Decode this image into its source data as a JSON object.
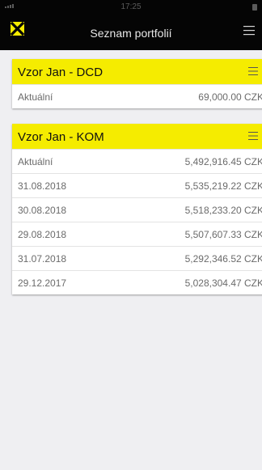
{
  "status_bar": {
    "time": "17:25"
  },
  "nav": {
    "title": "Seznam portfolií"
  },
  "portfolios": [
    {
      "name": "Vzor Jan - DCD",
      "rows": [
        {
          "label": "Aktuální",
          "value": "69,000.00 CZK"
        }
      ]
    },
    {
      "name": "Vzor Jan - KOM",
      "rows": [
        {
          "label": "Aktuální",
          "value": "5,492,916.45 CZK"
        },
        {
          "label": "31.08.2018",
          "value": "5,535,219.22 CZK"
        },
        {
          "label": "30.08.2018",
          "value": "5,518,233.20 CZK"
        },
        {
          "label": "29.08.2018",
          "value": "5,507,607.33 CZK"
        },
        {
          "label": "31.07.2018",
          "value": "5,292,346.52 CZK"
        },
        {
          "label": "29.12.2017",
          "value": "5,028,304.47 CZK"
        }
      ]
    }
  ],
  "colors": {
    "accent": "#f5ec00",
    "nav_background": "#050505",
    "page_background": "#efeff2"
  }
}
